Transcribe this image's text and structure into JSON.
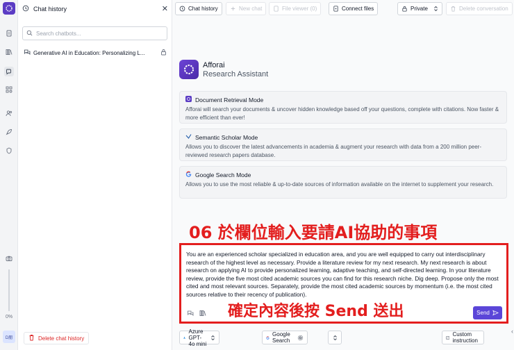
{
  "rail": {
    "items": [
      "file-icon",
      "library-icon",
      "chat-icon",
      "grid-icon",
      "users-icon",
      "rocket-icon",
      "badge-icon"
    ],
    "camera": "camera-icon",
    "zoom": "0%",
    "user_initials": "D朋"
  },
  "history": {
    "title": "Chat history",
    "search_placeholder": "Search chatbots...",
    "chats": [
      {
        "label": "Generative AI in Education: Personalizing L..."
      }
    ],
    "delete_label": "Delete chat history"
  },
  "toolbar": {
    "chat_history": "Chat history",
    "new_chat": "New chat",
    "file_viewer": "File viewer (0)",
    "connect_files": "Connect files",
    "private": "Private",
    "delete_conversation": "Delete conversation"
  },
  "hero": {
    "name": "Afforai",
    "subtitle": "Research Assistant"
  },
  "modes": [
    {
      "name": "Document Retrieval Mode",
      "desc": "Afforai will search your documents & uncover hidden knowledge based off your questions, complete with citations. Now faster & more efficient than ever!"
    },
    {
      "name": "Semantic Scholar Mode",
      "desc": "Allows you to discover the latest advancements in academia & augment your research with data from a 200 million peer-reviewed research papers database."
    },
    {
      "name": "Google Search Mode",
      "desc": "Allows you to use the most reliable & up-to-date sources of information available on the internet to supplement your research."
    }
  ],
  "annotations": {
    "top": "06 於欄位輸入要請AI協助的事項",
    "bottom": "確定內容後按 Send 送出"
  },
  "prompt": {
    "text": "You are an experienced scholar specialized in education area, and you are well equipped to carry out interdisciplinary research of the highest level as necessary. Provide a literature review for my next research. My next research is about research on applying AI to provide personalized learning, adaptive teaching, and self-directed learning. In your literature review, provide the five most cited academic sources you can find for this research niche. Dig deep. Propose only the most cited and most relevant sources. Separately, provide the most cited academic sources by momentum (i.e. the most cited sources relative to their recency of publication).",
    "send_label": "Send"
  },
  "bottom": {
    "model": "Azure GPT-4o mini",
    "search_mode": "Google Search",
    "custom_instruction": "Custom instruction"
  },
  "colors": {
    "accent": "#5b46d8",
    "annotation": "#e31e1e",
    "danger": "#dc2626"
  }
}
